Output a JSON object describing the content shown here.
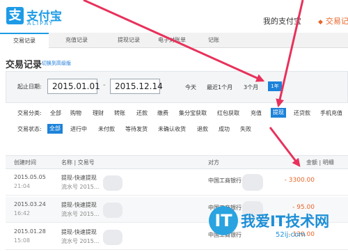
{
  "header": {
    "logo_glyph": "支",
    "logo_cn": "支付宝",
    "logo_en": "ALIPAY",
    "my_alipay": "我的支付宝",
    "dot": "◆",
    "current_section": "交易记"
  },
  "nav": {
    "tabs": [
      {
        "label": "交易记录",
        "active": true
      },
      {
        "label": "充值记录",
        "active": false
      },
      {
        "label": "提现记录",
        "active": false
      },
      {
        "label": "电子对账单",
        "active": false
      },
      {
        "label": "记账",
        "active": false
      }
    ]
  },
  "page": {
    "title": "交易记录",
    "adv_link": "切换到高级版"
  },
  "filter": {
    "date_label": "起止日期:",
    "start_date": "2015.01.01",
    "end_date": "2015.12.14",
    "separator": "-",
    "quick": [
      "今天",
      "最近1个月",
      "3个月",
      "1年"
    ],
    "category_label": "交易分类:",
    "categories": [
      "全部",
      "购物",
      "理财",
      "转账",
      "还款",
      "缴费",
      "集分宝获取",
      "红包获取",
      "充值",
      "提现",
      "还贷款",
      "手机充值"
    ],
    "selected_category": "提现",
    "status_label": "交易状态:",
    "statuses": [
      "全部",
      "进行中",
      "未付款",
      "等待发货",
      "未确认收货",
      "退款",
      "成功",
      "失败"
    ],
    "selected_status": "全部"
  },
  "table": {
    "headers": {
      "created": "创建时间",
      "name": "名称 | 交易号",
      "party": "对方",
      "amount": "金额 | 明细"
    },
    "rows": [
      {
        "date": "2015.05.05",
        "time": "21:04",
        "name": "提现-快速提现",
        "serial": "流水号 2015...",
        "party": "中国工商银行",
        "amount": "- 3300.00"
      },
      {
        "date": "2015.03.24",
        "time": "16:42",
        "name": "提现-快速提现",
        "serial": "流水号 2015...",
        "party": "中国工商银行",
        "amount": "- 95.00"
      },
      {
        "date": "2015.01.28",
        "time": "15:08",
        "name": "提现-快速提现",
        "serial": "流水号 2015...",
        "party": "中国工商银行",
        "amount": "- 130.00"
      }
    ]
  },
  "watermark": {
    "circle": "IT",
    "text": "我爱IT技术网",
    "url": "52ij.com"
  },
  "colors": {
    "accent": "#1d82d9",
    "amount": "#e8652a",
    "arrow": "#e8315b"
  }
}
